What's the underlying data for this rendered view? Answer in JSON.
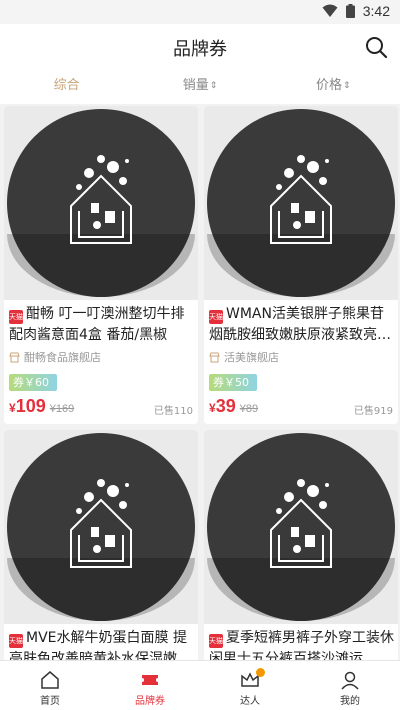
{
  "status_bar": {
    "time": "3:42",
    "icons": [
      "wifi-icon",
      "battery-icon"
    ]
  },
  "header": {
    "title": "品牌券",
    "search_icon": "search-icon"
  },
  "sort_tabs": [
    {
      "label": "综合",
      "active": true
    },
    {
      "label": "销量",
      "arrow": "⇕"
    },
    {
      "label": "价格",
      "arrow": "⇕"
    }
  ],
  "products": [
    {
      "tag": "天猫",
      "title": "酣畅 叮一叮澳洲整切牛排配肉酱意面4盒 番茄/黑椒牛…",
      "shop": "酣畅食品旗舰店",
      "coupon": "券￥60",
      "currency": "¥",
      "price": "109",
      "original_price": "¥169",
      "sold": "已售110"
    },
    {
      "tag": "天猫",
      "title": "WMAN活美银胖子熊果苷烟酰胺细致嫩肤原液紧致亮…",
      "shop": "活美旗舰店",
      "coupon": "券￥50",
      "currency": "¥",
      "price": "39",
      "original_price": "¥89",
      "sold": "已售919"
    },
    {
      "tag": "天猫",
      "title": "MVE水解牛奶蛋白面膜 提亮肤色改善暗黄补水保湿嫩",
      "shop": "",
      "coupon": "",
      "currency": "",
      "price": "",
      "original_price": "",
      "sold": ""
    },
    {
      "tag": "天猫",
      "title": "夏季短裤男裤子外穿工装休闲男士五分裤百搭沙滩运",
      "shop": "",
      "coupon": "",
      "currency": "",
      "price": "",
      "original_price": "",
      "sold": ""
    }
  ],
  "tabbar": [
    {
      "label": "首页",
      "icon": "home-icon"
    },
    {
      "label": "品牌券",
      "icon": "coupon-icon",
      "active": true
    },
    {
      "label": "达人",
      "icon": "crown-icon",
      "badge": true
    },
    {
      "label": "我的",
      "icon": "user-icon"
    }
  ],
  "colors": {
    "accent": "#e4303b",
    "sort_active": "#c9a479",
    "coupon_from": "#b6db78",
    "coupon_to": "#8fd3e3"
  }
}
